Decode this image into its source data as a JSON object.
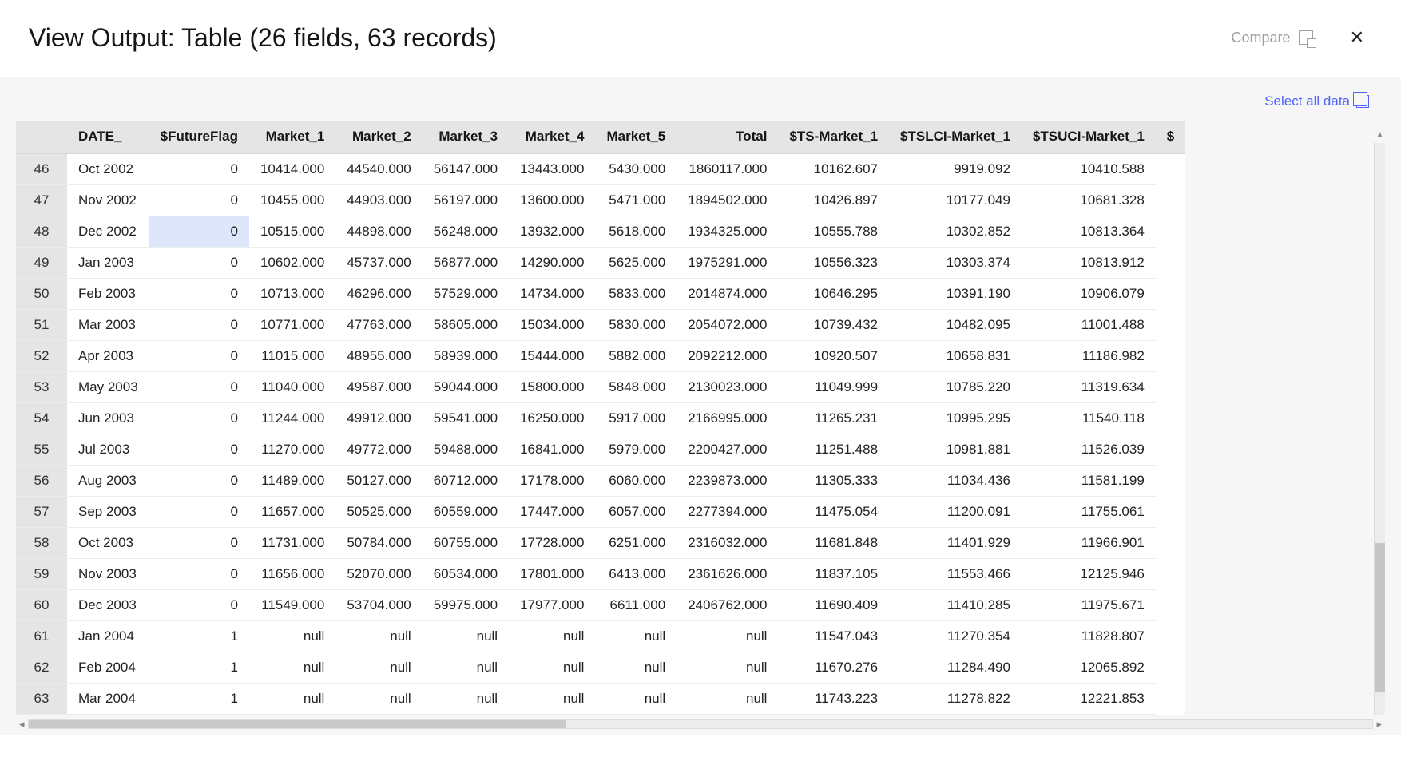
{
  "header": {
    "title": "View Output: Table (26 fields, 63 records)",
    "compare_label": "Compare"
  },
  "actions": {
    "select_all_label": "Select all data"
  },
  "table": {
    "columns": [
      "",
      "DATE_",
      "$FutureFlag",
      "Market_1",
      "Market_2",
      "Market_3",
      "Market_4",
      "Market_5",
      "Total",
      "$TS-Market_1",
      "$TSLCI-Market_1",
      "$TSUCI-Market_1",
      "$"
    ],
    "rows": [
      {
        "n": "46",
        "date": "Oct 2002",
        "ff": "0",
        "m1": "10414.000",
        "m2": "44540.000",
        "m3": "56147.000",
        "m4": "13443.000",
        "m5": "5430.000",
        "tot": "1860117.000",
        "ts": "10162.607",
        "lci": "9919.092",
        "uci": "10410.588"
      },
      {
        "n": "47",
        "date": "Nov 2002",
        "ff": "0",
        "m1": "10455.000",
        "m2": "44903.000",
        "m3": "56197.000",
        "m4": "13600.000",
        "m5": "5471.000",
        "tot": "1894502.000",
        "ts": "10426.897",
        "lci": "10177.049",
        "uci": "10681.328"
      },
      {
        "n": "48",
        "date": "Dec 2002",
        "ff": "0",
        "m1": "10515.000",
        "m2": "44898.000",
        "m3": "56248.000",
        "m4": "13932.000",
        "m5": "5618.000",
        "tot": "1934325.000",
        "ts": "10555.788",
        "lci": "10302.852",
        "uci": "10813.364",
        "hl_ff": true
      },
      {
        "n": "49",
        "date": "Jan 2003",
        "ff": "0",
        "m1": "10602.000",
        "m2": "45737.000",
        "m3": "56877.000",
        "m4": "14290.000",
        "m5": "5625.000",
        "tot": "1975291.000",
        "ts": "10556.323",
        "lci": "10303.374",
        "uci": "10813.912"
      },
      {
        "n": "50",
        "date": "Feb 2003",
        "ff": "0",
        "m1": "10713.000",
        "m2": "46296.000",
        "m3": "57529.000",
        "m4": "14734.000",
        "m5": "5833.000",
        "tot": "2014874.000",
        "ts": "10646.295",
        "lci": "10391.190",
        "uci": "10906.079"
      },
      {
        "n": "51",
        "date": "Mar 2003",
        "ff": "0",
        "m1": "10771.000",
        "m2": "47763.000",
        "m3": "58605.000",
        "m4": "15034.000",
        "m5": "5830.000",
        "tot": "2054072.000",
        "ts": "10739.432",
        "lci": "10482.095",
        "uci": "11001.488"
      },
      {
        "n": "52",
        "date": "Apr 2003",
        "ff": "0",
        "m1": "11015.000",
        "m2": "48955.000",
        "m3": "58939.000",
        "m4": "15444.000",
        "m5": "5882.000",
        "tot": "2092212.000",
        "ts": "10920.507",
        "lci": "10658.831",
        "uci": "11186.982"
      },
      {
        "n": "53",
        "date": "May 2003",
        "ff": "0",
        "m1": "11040.000",
        "m2": "49587.000",
        "m3": "59044.000",
        "m4": "15800.000",
        "m5": "5848.000",
        "tot": "2130023.000",
        "ts": "11049.999",
        "lci": "10785.220",
        "uci": "11319.634"
      },
      {
        "n": "54",
        "date": "Jun 2003",
        "ff": "0",
        "m1": "11244.000",
        "m2": "49912.000",
        "m3": "59541.000",
        "m4": "16250.000",
        "m5": "5917.000",
        "tot": "2166995.000",
        "ts": "11265.231",
        "lci": "10995.295",
        "uci": "11540.118"
      },
      {
        "n": "55",
        "date": "Jul 2003",
        "ff": "0",
        "m1": "11270.000",
        "m2": "49772.000",
        "m3": "59488.000",
        "m4": "16841.000",
        "m5": "5979.000",
        "tot": "2200427.000",
        "ts": "11251.488",
        "lci": "10981.881",
        "uci": "11526.039"
      },
      {
        "n": "56",
        "date": "Aug 2003",
        "ff": "0",
        "m1": "11489.000",
        "m2": "50127.000",
        "m3": "60712.000",
        "m4": "17178.000",
        "m5": "6060.000",
        "tot": "2239873.000",
        "ts": "11305.333",
        "lci": "11034.436",
        "uci": "11581.199"
      },
      {
        "n": "57",
        "date": "Sep 2003",
        "ff": "0",
        "m1": "11657.000",
        "m2": "50525.000",
        "m3": "60559.000",
        "m4": "17447.000",
        "m5": "6057.000",
        "tot": "2277394.000",
        "ts": "11475.054",
        "lci": "11200.091",
        "uci": "11755.061"
      },
      {
        "n": "58",
        "date": "Oct 2003",
        "ff": "0",
        "m1": "11731.000",
        "m2": "50784.000",
        "m3": "60755.000",
        "m4": "17728.000",
        "m5": "6251.000",
        "tot": "2316032.000",
        "ts": "11681.848",
        "lci": "11401.929",
        "uci": "11966.901"
      },
      {
        "n": "59",
        "date": "Nov 2003",
        "ff": "0",
        "m1": "11656.000",
        "m2": "52070.000",
        "m3": "60534.000",
        "m4": "17801.000",
        "m5": "6413.000",
        "tot": "2361626.000",
        "ts": "11837.105",
        "lci": "11553.466",
        "uci": "12125.946"
      },
      {
        "n": "60",
        "date": "Dec 2003",
        "ff": "0",
        "m1": "11549.000",
        "m2": "53704.000",
        "m3": "59975.000",
        "m4": "17977.000",
        "m5": "6611.000",
        "tot": "2406762.000",
        "ts": "11690.409",
        "lci": "11410.285",
        "uci": "11975.671"
      },
      {
        "n": "61",
        "date": "Jan 2004",
        "ff": "1",
        "m1": "null",
        "m2": "null",
        "m3": "null",
        "m4": "null",
        "m5": "null",
        "tot": "null",
        "ts": "11547.043",
        "lci": "11270.354",
        "uci": "11828.807"
      },
      {
        "n": "62",
        "date": "Feb 2004",
        "ff": "1",
        "m1": "null",
        "m2": "null",
        "m3": "null",
        "m4": "null",
        "m5": "null",
        "tot": "null",
        "ts": "11670.276",
        "lci": "11284.490",
        "uci": "12065.892"
      },
      {
        "n": "63",
        "date": "Mar 2004",
        "ff": "1",
        "m1": "null",
        "m2": "null",
        "m3": "null",
        "m4": "null",
        "m5": "null",
        "tot": "null",
        "ts": "11743.223",
        "lci": "11278.822",
        "uci": "12221.853"
      }
    ]
  }
}
